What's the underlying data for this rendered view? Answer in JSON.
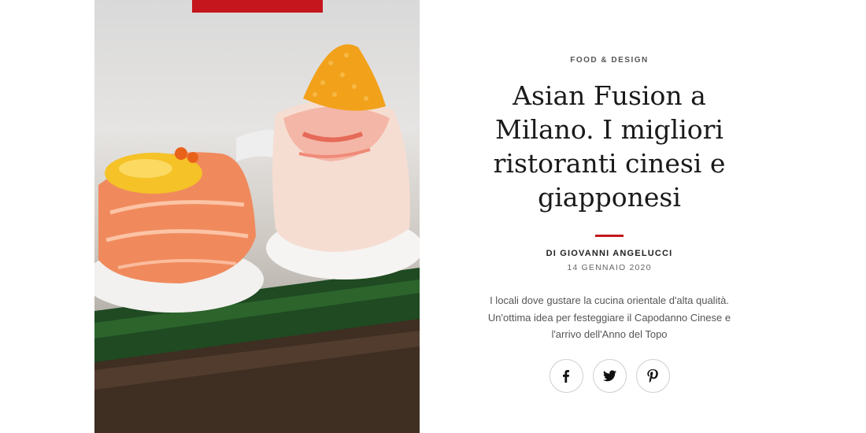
{
  "article": {
    "category": "FOOD & DESIGN",
    "title": "Asian Fusion a Milano. I migliori ristoranti cinesi e giapponesi",
    "author": "DI GIOVANNI ANGELUCCI",
    "date": "14 GENNAIO 2020",
    "description": "I locali dove gustare la cucina orientale d'alta qualità. Un'ottima idea per festeggiare il Capodanno Cinese e l'arrivo dell'Anno del Topo"
  },
  "share": {
    "buttons": [
      {
        "icon": "facebook-icon"
      },
      {
        "icon": "twitter-icon"
      },
      {
        "icon": "pinterest-icon"
      }
    ]
  },
  "colors": {
    "accent": "#c4161c",
    "text": "#1a1a1a",
    "muted": "#555555"
  }
}
